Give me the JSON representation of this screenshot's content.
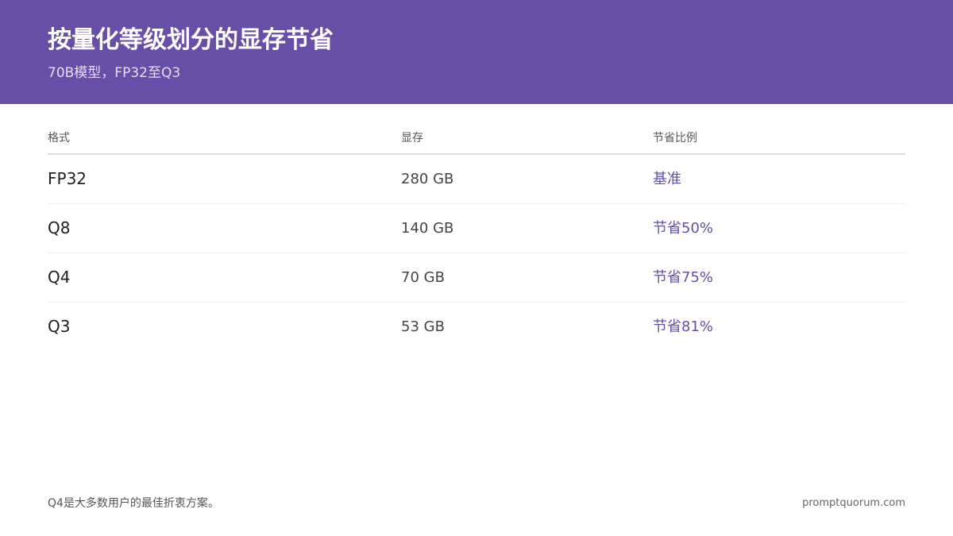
{
  "header": {
    "title": "按量化等级划分的显存节省",
    "subtitle": "70B模型，FP32至Q3"
  },
  "table": {
    "columns": [
      "格式",
      "显存",
      "节省比例"
    ],
    "rows": [
      {
        "format": "FP32",
        "memory": "280 GB",
        "savings": "基准"
      },
      {
        "format": "Q8",
        "memory": "140 GB",
        "savings": "节省50%"
      },
      {
        "format": "Q4",
        "memory": "70 GB",
        "savings": "节省75%"
      },
      {
        "format": "Q3",
        "memory": "53 GB",
        "savings": "节省81%"
      }
    ]
  },
  "footer": {
    "note": "Q4是大多数用户的最佳折衷方案。",
    "brand": "promptquorum.com"
  },
  "colors": {
    "accent": "#674ea7",
    "header_background": "#674ea7",
    "text_primary": "#1f1f1f",
    "text_secondary": "#555555"
  }
}
